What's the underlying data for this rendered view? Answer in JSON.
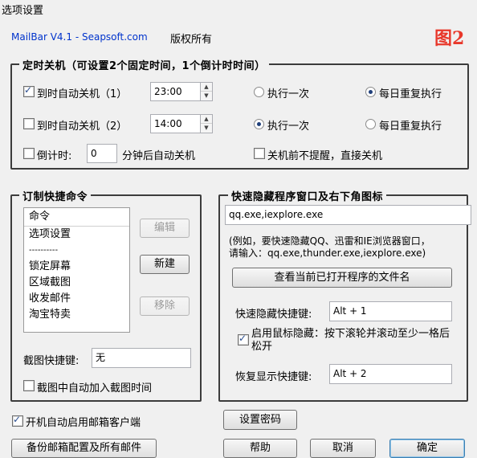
{
  "window": {
    "title": "选项设置"
  },
  "header": {
    "app": "MailBar V4.1 - Seapsoft.com",
    "copyright": "版权所有",
    "figure_label": "图2"
  },
  "timer": {
    "legend": "定时关机（可设置2个固定时间，1个倒计时时间）",
    "row1": {
      "label": "到时自动关机（1）",
      "time": "23:00",
      "once": "执行一次",
      "daily": "每日重复执行"
    },
    "row2": {
      "label": "到时自动关机（2）",
      "time": "14:00",
      "once": "执行一次",
      "daily": "每日重复执行"
    },
    "countdown": {
      "label": "倒计时:",
      "value": "0",
      "suffix": "分钟后自动关机",
      "no_prompt": "关机前不提醒，直接关机"
    }
  },
  "commands": {
    "legend": "订制快捷命令",
    "items": [
      "命令",
      "选项设置",
      "----------",
      "锁定屏幕",
      "区域截图",
      "收发邮件",
      "淘宝特卖"
    ],
    "edit": "编辑",
    "new": "新建",
    "remove": "移除",
    "hotkey_label": "截图快捷键:",
    "hotkey_value": "无",
    "add_time": "截图中自动加入截图时间"
  },
  "hide": {
    "legend": "快速隐藏程序窗口及右下角图标",
    "programs": "qq.exe,iexplore.exe",
    "hint": "(例如，要快速隐藏QQ、迅雷和IE浏览器窗口，\n请输入：qq.exe,thunder.exe,iexplore.exe)",
    "view_button": "查看当前已打开程序的文件名",
    "hide_hotkey_label": "快速隐藏快捷键:",
    "hide_hotkey": "Alt + 1",
    "mouse_hide": "启用鼠标隐藏：按下滚轮并滚动至少一格后松开",
    "restore_label": "恢复显示快捷键:",
    "restore_hotkey": "Alt + 2"
  },
  "footer": {
    "autostart": "开机自动启用邮箱客户端",
    "set_password": "设置密码",
    "backup": "备份邮箱配置及所有邮件",
    "help": "帮助",
    "cancel": "取消",
    "ok": "确定"
  }
}
